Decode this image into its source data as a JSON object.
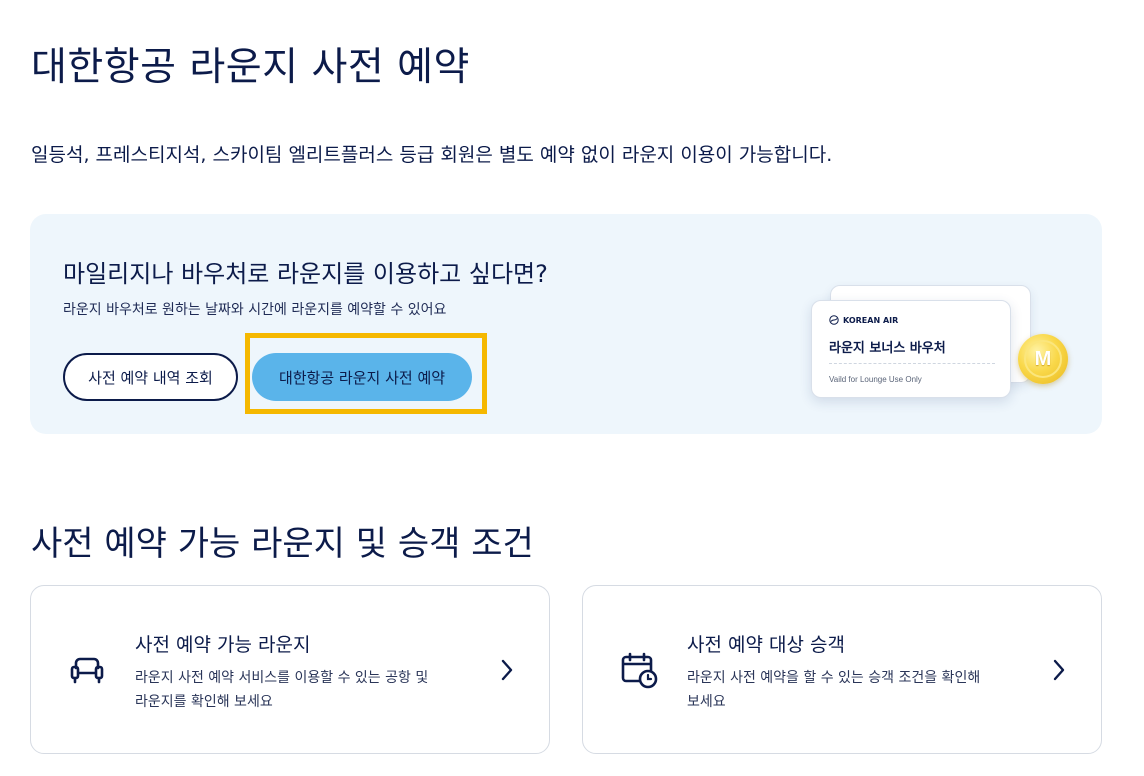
{
  "page": {
    "title": "대한항공 라운지 사전 예약",
    "intro": "일등석, 프레스티지석, 스카이팀 엘리트플러스 등급 회원은 별도 예약 없이 라운지 이용이 가능합니다."
  },
  "promo": {
    "heading": "마일리지나 바우처로 라운지를 이용하고 싶다면?",
    "subtext": "라운지 바우처로 원하는 날짜와 시간에 라운지를 예약할 수 있어요",
    "history_button": "사전 예약 내역 조회",
    "reserve_button": "대한항공 라운지 사전 예약",
    "voucher": {
      "brand": "KOREAN AIR",
      "title": "라운지 보너스 바우처",
      "note": "Vaild for Lounge Use Only",
      "coin_letter": "M"
    }
  },
  "section": {
    "title": "사전 예약 가능 라운지 및 승객 조건"
  },
  "cards": [
    {
      "title": "사전 예약 가능 라운지",
      "desc_line1": "라운지 사전 예약 서비스를 이용할 수 있는 공항 및",
      "desc_line2": "라운지를 확인해 보세요",
      "icon": "armchair-icon"
    },
    {
      "title": "사전 예약 대상 승객",
      "desc_line1": "라운지 사전 예약을 할 수 있는 승객 조건을 확인해",
      "desc_line2": "보세요",
      "icon": "calendar-clock-icon"
    }
  ],
  "colors": {
    "navy": "#0c1b4a",
    "accent_blue": "#5ab4ea",
    "highlight": "#f5b800",
    "promo_bg": "#eef6fc"
  }
}
